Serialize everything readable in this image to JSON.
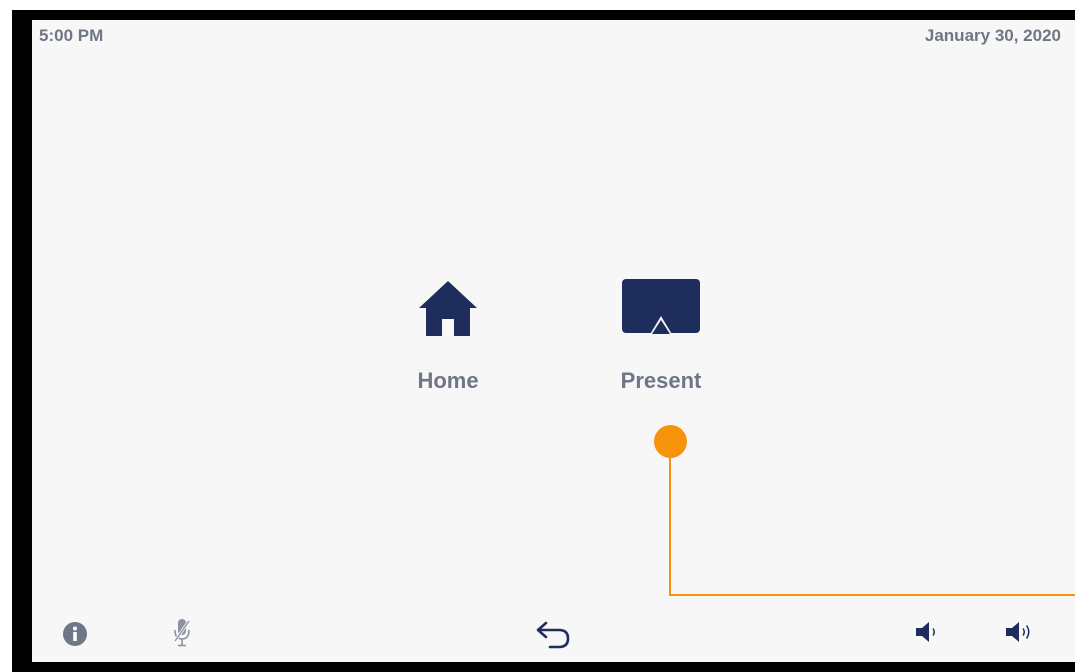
{
  "status": {
    "time": "5:00 PM",
    "date": "January 30, 2020"
  },
  "menu": {
    "items": [
      {
        "label": "Home",
        "icon": "home-icon"
      },
      {
        "label": "Present",
        "icon": "airplay-icon"
      }
    ]
  },
  "bottom_bar": {
    "icons": [
      "info-icon",
      "microphone-muted-icon",
      "back-arrow-icon",
      "volume-down-icon",
      "volume-up-icon"
    ]
  },
  "colors": {
    "accent": "#1e2d5c",
    "text_gray": "#6f7686",
    "callout": "#f7930b",
    "screen_bg": "#f7f7f8"
  }
}
